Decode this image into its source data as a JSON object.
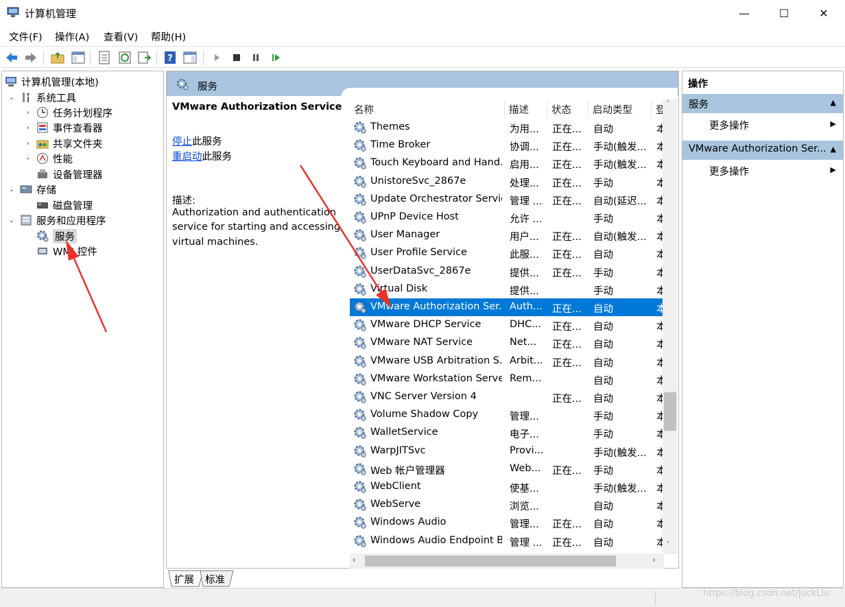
{
  "window": {
    "title": "计算机管理",
    "minimize": "—",
    "maximize": "☐",
    "close": "✕"
  },
  "menu": [
    "文件(F)",
    "操作(A)",
    "查看(V)",
    "帮助(H)"
  ],
  "toolbar_icons": [
    "back-icon",
    "forward-icon",
    "up-folder-icon",
    "show-hide-tree-icon",
    "properties-icon",
    "refresh-icon",
    "export-list-icon",
    "help-icon",
    "show-hide-action-icon",
    "start-service-icon",
    "stop-service-icon",
    "pause-service-icon",
    "restart-service-icon"
  ],
  "tree": {
    "root": "计算机管理(本地)",
    "system_tools": "系统工具",
    "task_scheduler": "任务计划程序",
    "event_viewer": "事件查看器",
    "shared_folders": "共享文件夹",
    "performance": "性能",
    "device_manager": "设备管理器",
    "storage": "存储",
    "disk_management": "磁盘管理",
    "services_apps": "服务和应用程序",
    "services": "服务",
    "wmi": "WMI 控件"
  },
  "center": {
    "header": "服务",
    "selected_title": "VMware Authorization Service",
    "stop_link": "停止",
    "stop_suffix": "此服务",
    "restart_link": "重启动",
    "restart_suffix": "此服务",
    "desc_label": "描述:",
    "desc_lines": [
      "Authorization and authentication",
      "service for starting and accessing",
      "virtual machines."
    ]
  },
  "columns": [
    "名称",
    "描述",
    "状态",
    "启动类型",
    "登"
  ],
  "sort_indicator": "^",
  "services": [
    {
      "name": "Themes",
      "desc": "为用...",
      "status": "正在...",
      "startup": "自动",
      "logon": "本"
    },
    {
      "name": "Time Broker",
      "desc": "协调...",
      "status": "正在...",
      "startup": "手动(触发...",
      "logon": "本"
    },
    {
      "name": "Touch Keyboard and Hand...",
      "desc": "启用...",
      "status": "正在...",
      "startup": "手动(触发...",
      "logon": "本"
    },
    {
      "name": "UnistoreSvc_2867e",
      "desc": "处理...",
      "status": "正在...",
      "startup": "手动",
      "logon": "本"
    },
    {
      "name": "Update Orchestrator Service",
      "desc": "管理 ...",
      "status": "正在...",
      "startup": "自动(延迟...",
      "logon": "本"
    },
    {
      "name": "UPnP Device Host",
      "desc": "允许 ...",
      "status": "",
      "startup": "手动",
      "logon": "本"
    },
    {
      "name": "User Manager",
      "desc": "用户...",
      "status": "正在...",
      "startup": "自动(触发...",
      "logon": "本"
    },
    {
      "name": "User Profile Service",
      "desc": "此服...",
      "status": "正在...",
      "startup": "自动",
      "logon": "本"
    },
    {
      "name": "UserDataSvc_2867e",
      "desc": "提供...",
      "status": "正在...",
      "startup": "手动",
      "logon": "本"
    },
    {
      "name": "Virtual Disk",
      "desc": "提供...",
      "status": "",
      "startup": "手动",
      "logon": "本"
    },
    {
      "name": "VMware Authorization Ser...",
      "desc": "Auth...",
      "status": "正在...",
      "startup": "自动",
      "logon": "本",
      "selected": true
    },
    {
      "name": "VMware DHCP Service",
      "desc": "DHC...",
      "status": "正在...",
      "startup": "自动",
      "logon": "本"
    },
    {
      "name": "VMware NAT Service",
      "desc": "Net...",
      "status": "正在...",
      "startup": "自动",
      "logon": "本"
    },
    {
      "name": "VMware USB Arbitration S...",
      "desc": "Arbit...",
      "status": "正在...",
      "startup": "自动",
      "logon": "本"
    },
    {
      "name": "VMware Workstation Server",
      "desc": "Rem...",
      "status": "",
      "startup": "自动",
      "logon": "本"
    },
    {
      "name": "VNC Server Version 4",
      "desc": "",
      "status": "正在...",
      "startup": "自动",
      "logon": "本"
    },
    {
      "name": "Volume Shadow Copy",
      "desc": "管理...",
      "status": "",
      "startup": "手动",
      "logon": "本"
    },
    {
      "name": "WalletService",
      "desc": "电子...",
      "status": "",
      "startup": "手动",
      "logon": "本"
    },
    {
      "name": "WarpJITSvc",
      "desc": "Provi...",
      "status": "",
      "startup": "手动(触发...",
      "logon": "本"
    },
    {
      "name": "Web 帐户管理器",
      "desc": "Web...",
      "status": "正在...",
      "startup": "手动",
      "logon": "本"
    },
    {
      "name": "WebClient",
      "desc": "使基...",
      "status": "",
      "startup": "手动(触发...",
      "logon": "本"
    },
    {
      "name": "WebServe",
      "desc": "浏览...",
      "status": "",
      "startup": "自动",
      "logon": "本"
    },
    {
      "name": "Windows Audio",
      "desc": "管理...",
      "status": "正在...",
      "startup": "自动",
      "logon": "本"
    },
    {
      "name": "Windows Audio Endpoint B...",
      "desc": "管理 ...",
      "status": "正在...",
      "startup": "自动",
      "logon": "本"
    }
  ],
  "tabs": [
    "扩展",
    "标准"
  ],
  "actions": {
    "title": "操作",
    "group1": "服务",
    "group1_item": "更多操作",
    "group2": "VMware Authorization Ser...",
    "group2_item": "更多操作"
  },
  "watermark": "https://blog.csdn.net/JockLiu",
  "colors": {
    "selection": "#0078d7",
    "header_band": "#a8c4de",
    "annotation_arrow": "#e8332b",
    "link": "#0645d3"
  }
}
